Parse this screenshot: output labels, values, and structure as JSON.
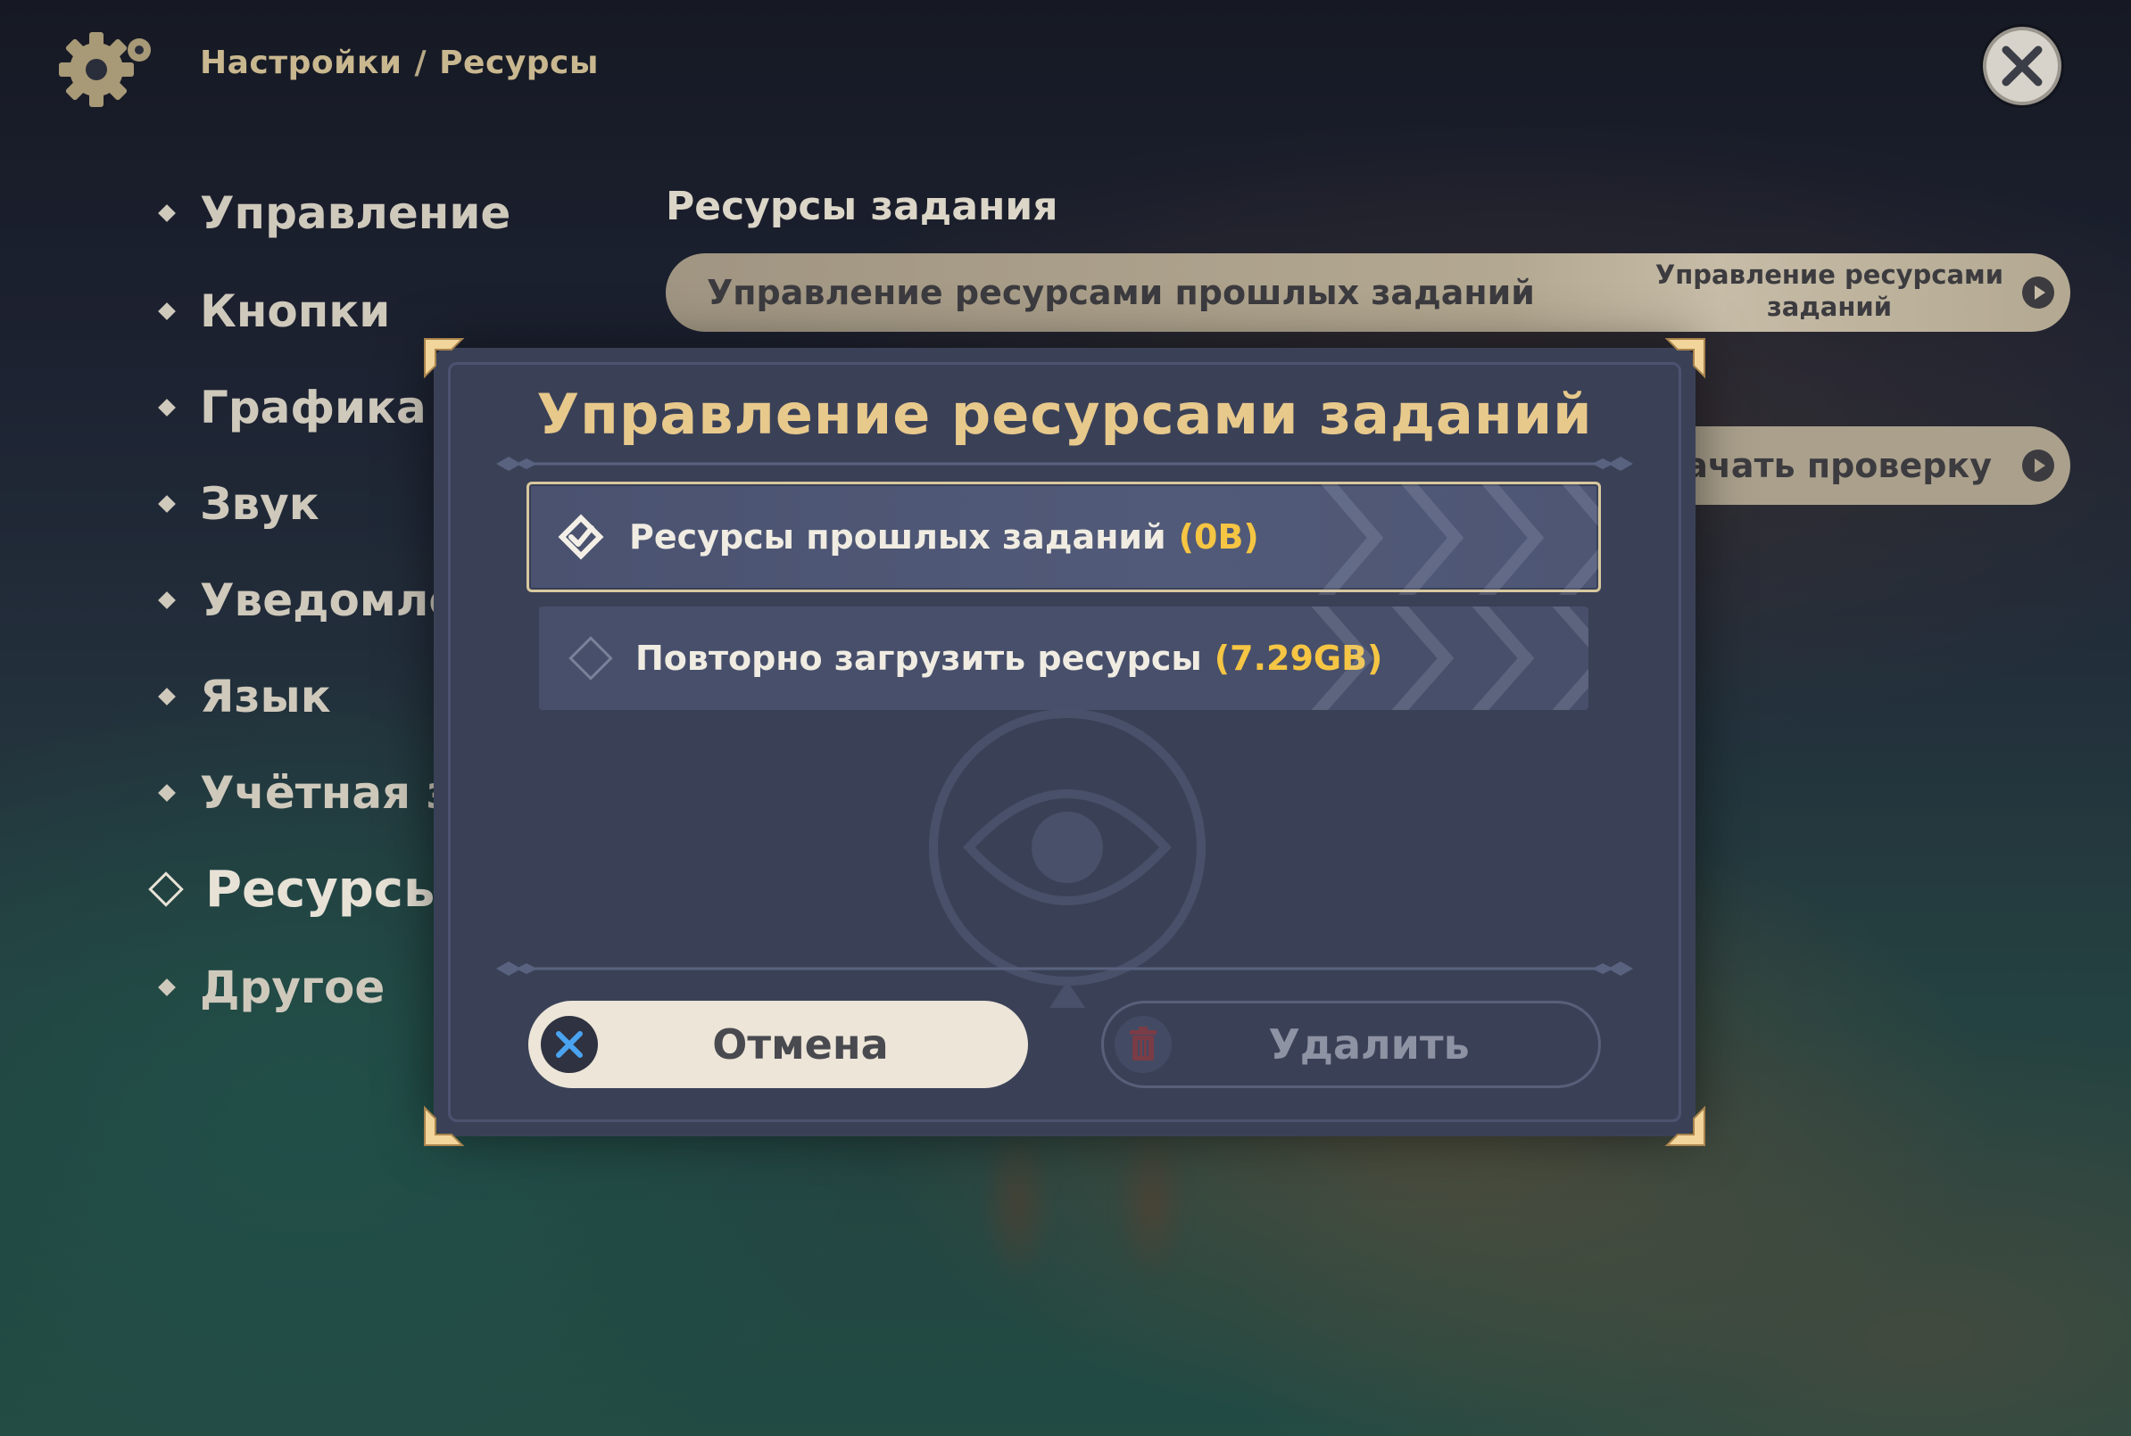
{
  "header": {
    "breadcrumb_parent": "Настройки",
    "breadcrumb_separator": "/",
    "breadcrumb_current": "Ресурсы",
    "settings_icon": "gear-icon",
    "close_icon": "close-icon"
  },
  "sidebar": {
    "items": [
      {
        "label": "Управление"
      },
      {
        "label": "Кнопки"
      },
      {
        "label": "Графика"
      },
      {
        "label": "Звук"
      },
      {
        "label": "Уведомле"
      },
      {
        "label": "Язык"
      },
      {
        "label": "Учётная з"
      },
      {
        "label": "Ресурсы"
      },
      {
        "label": "Другое"
      }
    ],
    "active_index": 7
  },
  "main": {
    "section_title": "Ресурсы задания",
    "rows": [
      {
        "label": "Управление ресурсами прошлых заданий",
        "button": "Управление ресурсами заданий"
      },
      {
        "button": "Начать проверку"
      }
    ]
  },
  "dialog": {
    "title": "Управление ресурсами заданий",
    "options": [
      {
        "label": "Ресурсы прошлых заданий",
        "size": "(0B)",
        "checked": true
      },
      {
        "label": "Повторно загрузить ресурсы",
        "size": "(7.29GB)",
        "checked": false
      }
    ],
    "cancel_label": "Отмена",
    "delete_label": "Удалить",
    "cancel_icon": "close-icon",
    "delete_icon": "trash-icon"
  },
  "colors": {
    "accent_gold": "#e8c98c",
    "size_yellow": "#f5c543",
    "dialog_bg": "#3a4157",
    "cancel_button_bg": "#ece5d8"
  }
}
